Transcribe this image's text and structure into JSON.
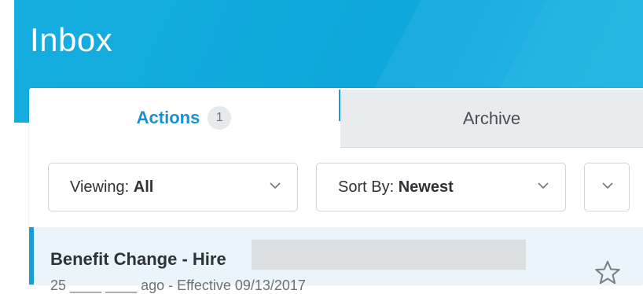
{
  "header": {
    "title": "Inbox"
  },
  "tabs": {
    "actions": {
      "label": "Actions",
      "count": "1"
    },
    "archive": {
      "label": "Archive"
    }
  },
  "filters": {
    "viewing": {
      "label": "Viewing:",
      "value": "All"
    },
    "sort": {
      "label": "Sort By:",
      "value": "Newest"
    }
  },
  "inbox_items": [
    {
      "title": "Benefit Change - Hire",
      "subtitle": "25 ____ ____ ago - Effective 09/13/2017"
    }
  ],
  "colors": {
    "brand": "#0fa8dc",
    "accent": "#1a8fd6",
    "selected_row": "#e9f5fb"
  },
  "icons": {
    "dropdown": "chevron-down-icon",
    "favorite": "star-outline-icon"
  }
}
